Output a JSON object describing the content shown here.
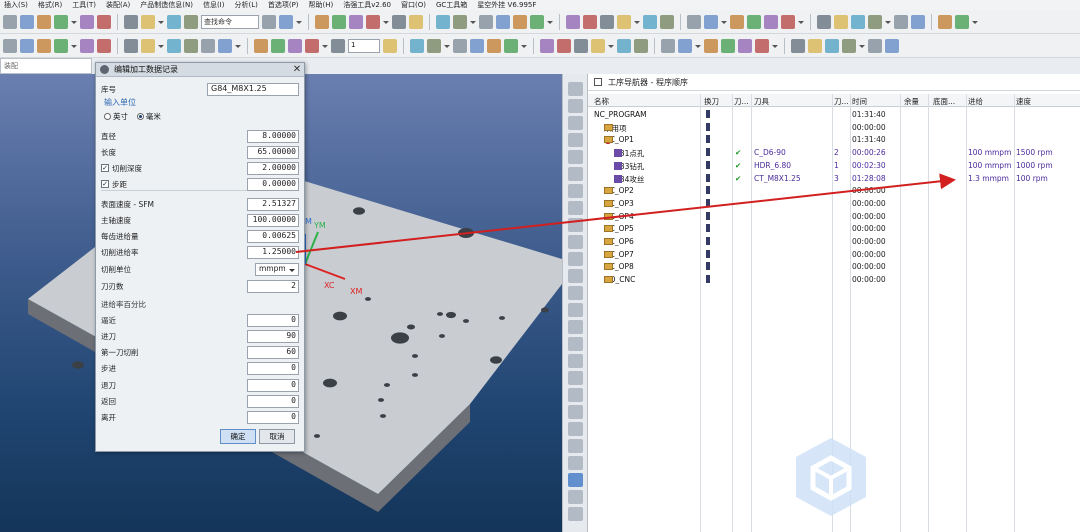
{
  "menubar": {
    "items": [
      "插入(S)",
      "格式(R)",
      "工具(T)",
      "装配(A)",
      "产品制造信息(N)",
      "信息(I)",
      "分析(L)",
      "首选项(P)",
      "帮助(H)",
      "浩强工具v2.60",
      "窗口(O)",
      "GC工具箱",
      "星空外挂 V6.995F"
    ]
  },
  "toolbar": {
    "search_placeholder": "查找命令",
    "layer_value": "1"
  },
  "filter": {
    "value": "装配"
  },
  "dialog": {
    "title": "编辑加工数据记录",
    "library_label": "库号",
    "library_value": "G84_M8X1.25",
    "unit_group_title": "输入单位",
    "unit_inch": "英寸",
    "unit_mm": "毫米",
    "unit_selected": "mm",
    "fields": [
      {
        "label": "直径",
        "value": "8.00000",
        "checkbox": false
      },
      {
        "label": "长度",
        "value": "65.00000",
        "checkbox": false
      },
      {
        "label": "切削深度",
        "value": "2.00000",
        "checkbox": true
      },
      {
        "label": "步距",
        "value": "0.00000",
        "checkbox": true
      }
    ],
    "fields2": [
      {
        "label": "表面速度 - SFM",
        "value": "2.51327"
      },
      {
        "label": "主轴速度",
        "value": "100.00000"
      },
      {
        "label": "每齿进给量",
        "value": "0.00625"
      },
      {
        "label": "切削进给率",
        "value": "1.25000"
      }
    ],
    "cut_unit_label": "切削单位",
    "cut_unit_value": "mmpm",
    "flutes_label": "刀刃数",
    "flutes_value": "2",
    "feed_percent_title": "进给率百分比",
    "feed_rows": [
      {
        "label": "逼近",
        "value": "0"
      },
      {
        "label": "进刀",
        "value": "90"
      },
      {
        "label": "第一刀切削",
        "value": "60"
      },
      {
        "label": "步进",
        "value": "0"
      },
      {
        "label": "退刀",
        "value": "0"
      },
      {
        "label": "返回",
        "value": "0"
      },
      {
        "label": "离开",
        "value": "0"
      }
    ],
    "ok_label": "确定",
    "cancel_label": "取消"
  },
  "viewport": {
    "axis_labels": {
      "ym": "YM",
      "xc": "XC",
      "xm": "XM",
      "zm": "M"
    }
  },
  "navigator": {
    "title": "工序导航器 - 程序顺序",
    "columns": [
      "名称",
      "换刀",
      "刀...",
      "刀具",
      "刀...",
      "时间",
      "余量",
      "底面...",
      "进给",
      "速度"
    ],
    "rows": [
      {
        "name": "NC_PROGRAM",
        "indent": 0,
        "kind": "root",
        "toolchg": "",
        "status": "",
        "tool": "",
        "tnum": "",
        "time": "01:31:40",
        "feed": "",
        "speed": ""
      },
      {
        "name": "未用项",
        "indent": 1,
        "kind": "folder",
        "toolchg": "",
        "status": "",
        "tool": "",
        "tnum": "",
        "time": "00:00:00",
        "feed": "",
        "speed": ""
      },
      {
        "name": "NC_OP1",
        "indent": 1,
        "kind": "nogo-folder",
        "toolchg": "",
        "status": "",
        "tool": "",
        "tnum": "",
        "time": "01:31:40",
        "feed": "",
        "speed": ""
      },
      {
        "name": "G81点孔",
        "indent": 2,
        "kind": "op-warn",
        "toolchg": "▮",
        "status": "✔",
        "tool": "C_D6-90",
        "tnum": "2",
        "time": "00:00:26",
        "feed": "100 mmpm",
        "speed": "1500 rpm"
      },
      {
        "name": "G83钻孔",
        "indent": 2,
        "kind": "op-ok",
        "toolchg": "▮",
        "status": "✔",
        "tool": "HDR_6.80",
        "tnum": "1",
        "time": "00:02:30",
        "feed": "100 mmpm",
        "speed": "1000 rpm"
      },
      {
        "name": "G84攻丝",
        "indent": 2,
        "kind": "op-nogo",
        "toolchg": "▮",
        "status": "✔",
        "tool": "CT_M8X1.25",
        "tnum": "3",
        "time": "01:28:08",
        "feed": "1.3 mmpm",
        "speed": "100 rpm"
      },
      {
        "name": "NC_OP2",
        "indent": 1,
        "kind": "ok-folder",
        "toolchg": "",
        "status": "",
        "tool": "",
        "tnum": "",
        "time": "00:00:00",
        "feed": "",
        "speed": ""
      },
      {
        "name": "NC_OP3",
        "indent": 1,
        "kind": "ok-folder",
        "toolchg": "",
        "status": "",
        "tool": "",
        "tnum": "",
        "time": "00:00:00",
        "feed": "",
        "speed": ""
      },
      {
        "name": "NC_OP4",
        "indent": 1,
        "kind": "ok-folder",
        "toolchg": "",
        "status": "",
        "tool": "",
        "tnum": "",
        "time": "00:00:00",
        "feed": "",
        "speed": ""
      },
      {
        "name": "NC_OP5",
        "indent": 1,
        "kind": "ok-folder",
        "toolchg": "",
        "status": "",
        "tool": "",
        "tnum": "",
        "time": "00:00:00",
        "feed": "",
        "speed": ""
      },
      {
        "name": "NC_OP6",
        "indent": 1,
        "kind": "ok-folder",
        "toolchg": "",
        "status": "",
        "tool": "",
        "tnum": "",
        "time": "00:00:00",
        "feed": "",
        "speed": ""
      },
      {
        "name": "NC_OP7",
        "indent": 1,
        "kind": "ok-folder",
        "toolchg": "",
        "status": "",
        "tool": "",
        "tnum": "",
        "time": "00:00:00",
        "feed": "",
        "speed": ""
      },
      {
        "name": "NC_OP8",
        "indent": 1,
        "kind": "ok-folder",
        "toolchg": "",
        "status": "",
        "tool": "",
        "tnum": "",
        "time": "00:00:00",
        "feed": "",
        "speed": ""
      },
      {
        "name": "NO_CNC",
        "indent": 1,
        "kind": "ok-folder",
        "toolchg": "",
        "status": "",
        "tool": "",
        "tnum": "",
        "time": "00:00:00",
        "feed": "",
        "speed": ""
      }
    ]
  },
  "colors": {
    "annotation_arrow": "#d21f1f",
    "nc_purple": "#4b2b9c",
    "status_green": "#1d9a2a",
    "viewport_top": "#6a7fb0",
    "viewport_bottom": "#143559"
  }
}
